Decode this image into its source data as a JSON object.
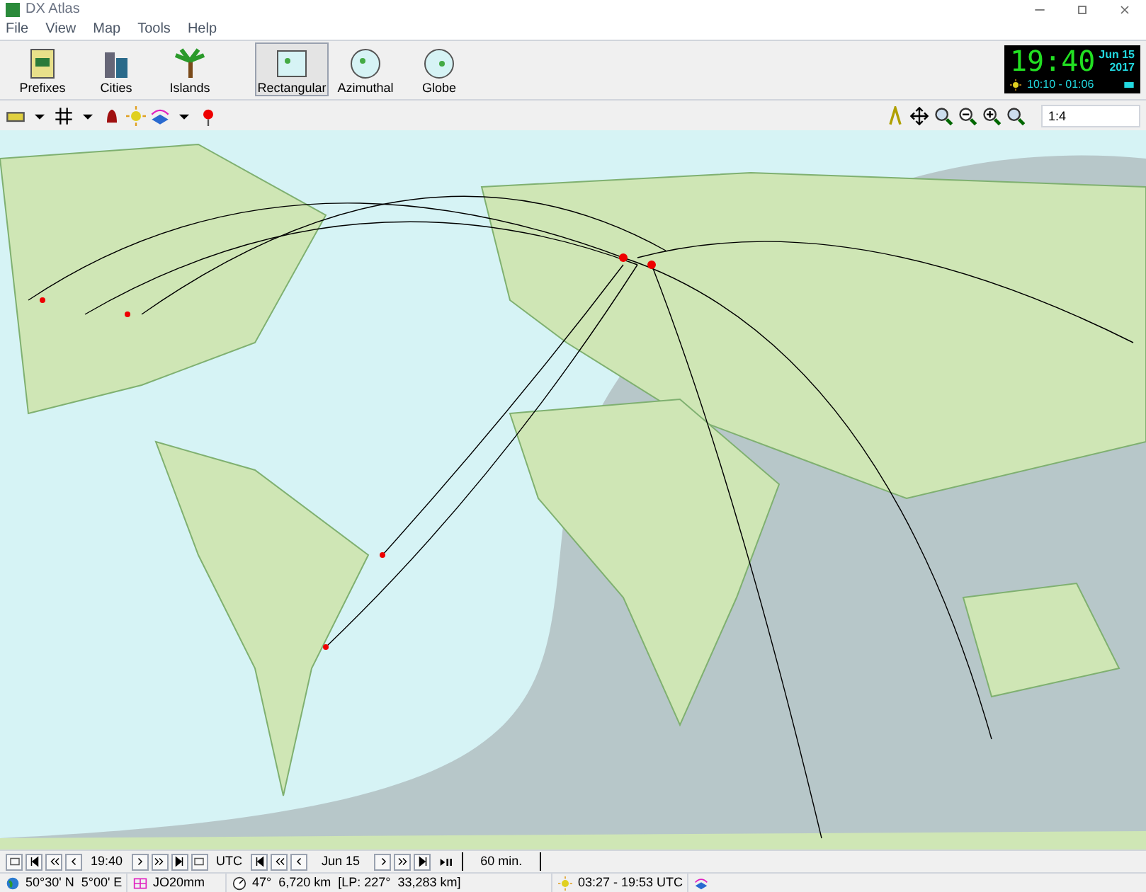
{
  "window": {
    "title": "DX Atlas"
  },
  "menu": [
    "File",
    "View",
    "Map",
    "Tools",
    "Help"
  ],
  "toolbar": [
    {
      "label": "Prefixes",
      "kind": "book",
      "selected": false
    },
    {
      "label": "Cities",
      "kind": "city",
      "selected": false
    },
    {
      "label": "Islands",
      "kind": "palm",
      "selected": false
    },
    {
      "label": "Rectangular",
      "kind": "rect",
      "selected": true
    },
    {
      "label": "Azimuthal",
      "kind": "azim",
      "selected": false
    },
    {
      "label": "Globe",
      "kind": "globe",
      "selected": false
    }
  ],
  "clock": {
    "time": "19:40",
    "date": "Jun 15",
    "year": "2017",
    "sun": "10:10 - 01:06"
  },
  "zoom_field": {
    "value": "1:4"
  },
  "time_bar": {
    "time": "19:40",
    "zone": "UTC",
    "date": "Jun 15",
    "step": "60 min."
  },
  "status_bar": [
    "50°30' N  5°00' E",
    "JO20mm",
    "47°  6,720 km  [LP: 227°  33,283 km]",
    "03:27 - 19:53 UTC"
  ]
}
